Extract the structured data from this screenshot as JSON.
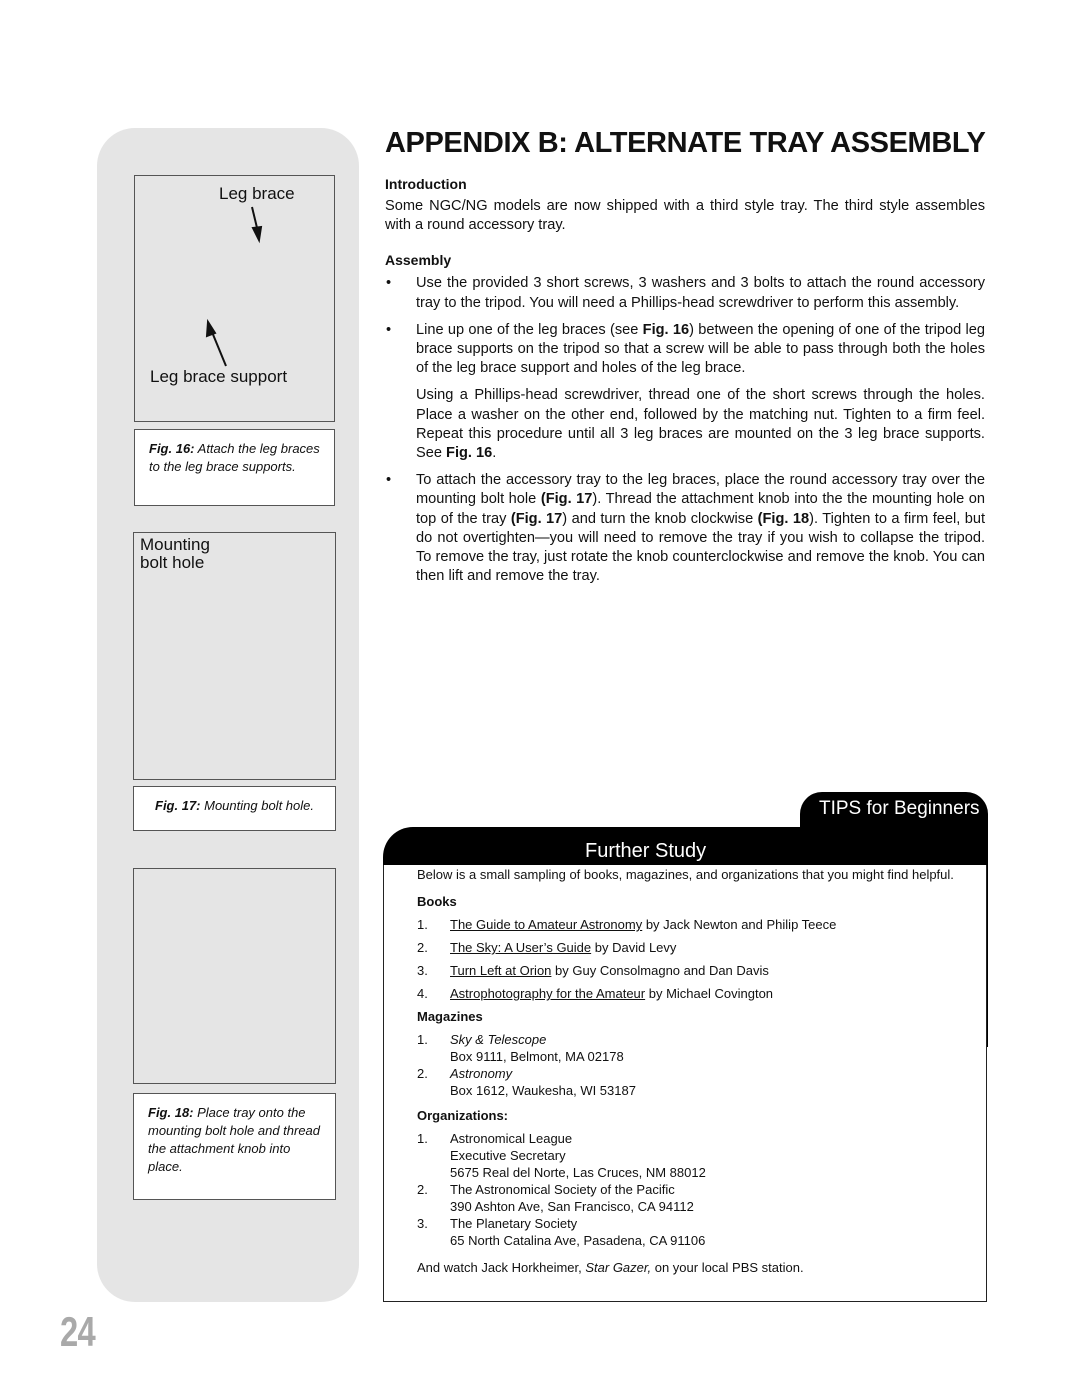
{
  "page_number": "24",
  "figures": {
    "fig16": {
      "label_top": "Leg brace",
      "label_bottom": "Leg brace support",
      "caption_num": "Fig. 16:",
      "caption_text": " Attach the leg braces to the leg brace supports."
    },
    "fig17": {
      "label_line1": "Mounting",
      "label_line2": "bolt hole",
      "caption_num": "Fig. 17:",
      "caption_text": " Mounting bolt hole."
    },
    "fig18": {
      "caption_num": "Fig. 18:",
      "caption_text": " Place tray onto the mounting bolt hole and thread the attachment knob into place."
    }
  },
  "main": {
    "title": "APPENDIX B: ALTERNATE TRAY ASSEMBLY",
    "intro_heading": "Introduction",
    "intro_text": "Some NGC/NG models are now shipped with a third style tray. The third style assembles with a round accessory tray.",
    "assembly_heading": "Assembly",
    "bullet_glyph": "•",
    "bullet1": "Use the provided 3 short screws, 3 washers and 3 bolts to attach the round accessory tray to the tripod. You will need a Phillips-head screwdriver to perform this assembly.",
    "bullet2_a": "Line up one of the leg braces (see ",
    "bullet2_fig": "Fig. 16",
    "bullet2_b": ") between the opening of one of the tripod leg brace supports  on the tripod so that a screw will be able to pass through both the holes of the leg brace support and holes of the leg brace.",
    "bullet2_sub_a": "Using a Phillips-head screwdriver, thread one of the short screws through the holes. Place a washer on the other end, followed by the matching nut. Tighten to a firm feel. Repeat this procedure until all 3 leg braces are mounted on the 3 leg brace supports. See ",
    "bullet2_sub_fig": "Fig. 16",
    "bullet2_sub_b": ".",
    "bullet3_a": "To attach the accessory tray to the leg braces, place the round accessory tray over the mounting bolt hole ",
    "bullet3_fig1": "(Fig. 17",
    "bullet3_b": "). Thread the attachment knob into the the mounting hole on top of the tray ",
    "bullet3_fig2": "(Fig. 17",
    "bullet3_c": ") and turn the knob clockwise ",
    "bullet3_fig3": "(Fig. 18",
    "bullet3_d": "). Tighten to a firm feel, but do not overtighten—you will need to remove the tray if you wish to collapse the tripod. To remove the tray, just rotate the knob counterclockwise and remove the knob. You can then lift and remove the tray."
  },
  "tips": {
    "tab_label": "TIPS for Beginners",
    "section_title": "Further Study",
    "intro": "Below is a small sampling of books, magazines, and organizations that you might find helpful.",
    "books_heading": "Books",
    "books": [
      {
        "num": "1.",
        "title": "The Guide to Amateur Astronomy",
        "author": " by Jack Newton and Philip Teece"
      },
      {
        "num": "2.",
        "title": "The Sky: A User’s Guide",
        "author": " by David Levy"
      },
      {
        "num": "3.",
        "title": "Turn Left at Orion",
        "author": " by Guy Consolmagno and Dan Davis"
      },
      {
        "num": "4.",
        "title": "Astrophotography for the Amateur",
        "author": " by Michael Covington"
      }
    ],
    "magazines_heading": "Magazines",
    "magazines": [
      {
        "num": "1.",
        "name": "Sky & Telescope",
        "address": "Box 9111, Belmont, MA 02178"
      },
      {
        "num": "2.",
        "name": "Astronomy",
        "address": "Box 1612, Waukesha, WI 53187"
      }
    ],
    "organizations_heading": "Organizations:",
    "organizations": [
      {
        "num": "1.",
        "lines": [
          "Astronomical League",
          "Executive Secretary",
          "5675 Real del Norte, Las Cruces, NM 88012"
        ]
      },
      {
        "num": "2.",
        "lines": [
          "The Astronomical Society of the Pacific",
          "390 Ashton Ave, San Francisco, CA 94112"
        ]
      },
      {
        "num": "3.",
        "lines": [
          "The Planetary Society",
          "65 North Catalina Ave, Pasadena, CA 91106"
        ]
      }
    ],
    "closing_a": "And watch Jack Horkheimer, ",
    "closing_show": "Star Gazer,",
    "closing_b": " on your local PBS station."
  }
}
